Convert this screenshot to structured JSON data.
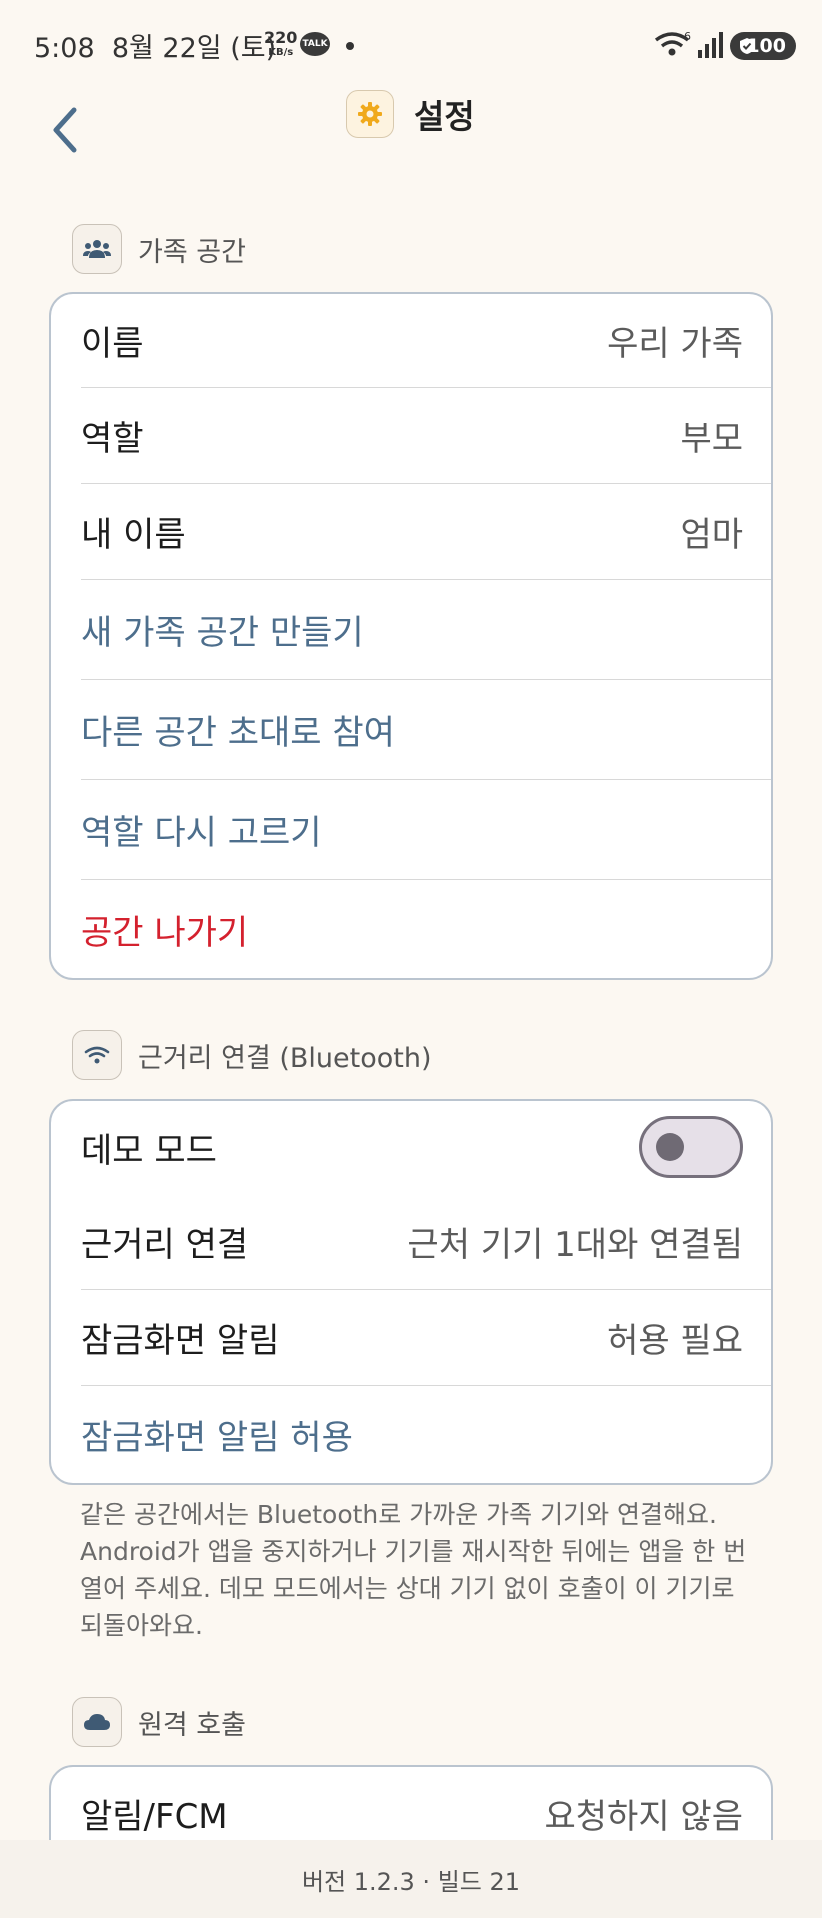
{
  "status_bar": {
    "time": "5:08",
    "date": "8월 22일 (토)",
    "speed_value": "220",
    "speed_unit": "KB/s",
    "talk_label": "TALK",
    "battery": "100"
  },
  "header": {
    "title": "설정",
    "title_icon": "gear-icon",
    "back_icon": "chevron-left-icon"
  },
  "family": {
    "title": "가족 공간",
    "icon": "people-icon",
    "rows": [
      {
        "label": "이름",
        "value": "우리 가족"
      },
      {
        "label": "역할",
        "value": "부모"
      },
      {
        "label": "내 이름",
        "value": "엄마"
      }
    ],
    "actions": {
      "create": "새 가족 공간 만들기",
      "join": "다른 공간 초대로 참여",
      "reselect_role": "역할 다시 고르기",
      "leave": "공간 나가기"
    }
  },
  "nearby": {
    "title": "근거리 연결 (Bluetooth)",
    "icon": "wifi-icon",
    "demo_mode_label": "데모 모드",
    "demo_mode_on": false,
    "rows": [
      {
        "label": "근거리 연결",
        "value": "근처 기기 1대와 연결됨"
      },
      {
        "label": "잠금화면 알림",
        "value": "허용 필요"
      }
    ],
    "allow_action": "잠금화면 알림 허용",
    "note": "같은 공간에서는 Bluetooth로 가까운 가족 기기와 연결해요. Android가 앱을 중지하거나 기기를 재시작한 뒤에는 앱을 한 번 열어 주세요. 데모 모드에서는 상대 기기 없이 호출이 이 기기로 되돌아와요."
  },
  "remote": {
    "title": "원격 호출",
    "icon": "cloud-icon",
    "rows": [
      {
        "label": "알림/FCM",
        "value": "요청하지 않음"
      }
    ]
  },
  "footer": {
    "version": "버전 1.2.3 · 빌드 21"
  },
  "colors": {
    "background": "#fcf8f2",
    "action": "#4d6e8c",
    "danger": "#d4212e",
    "accent": "#f0a91c"
  }
}
